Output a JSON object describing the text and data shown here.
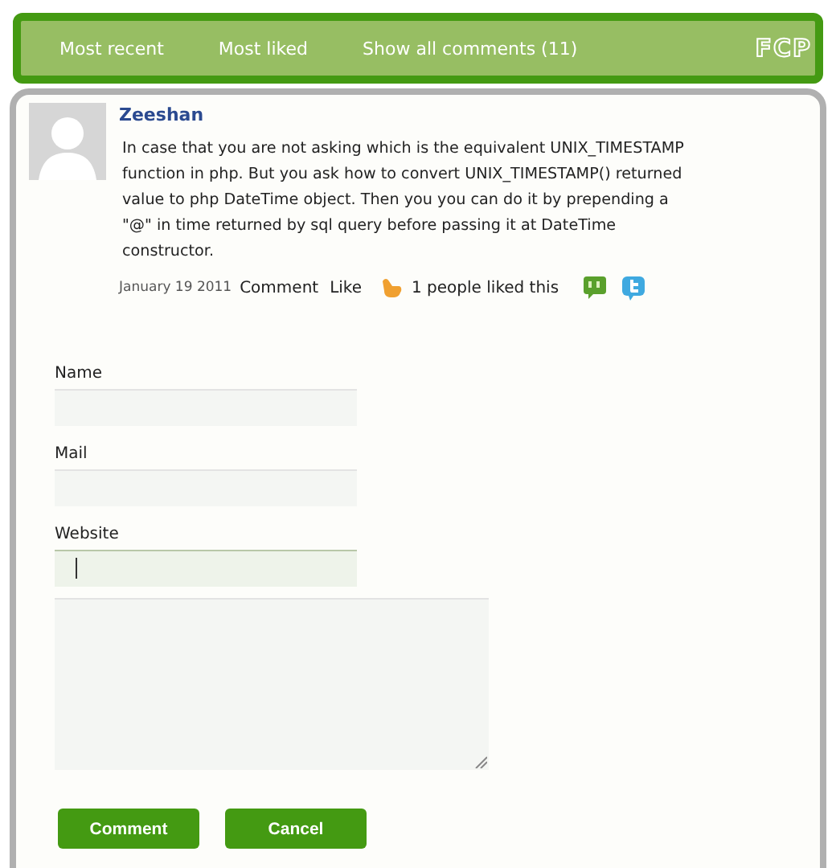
{
  "nav": {
    "tabs": [
      {
        "label": "Most recent"
      },
      {
        "label": "Most liked"
      },
      {
        "label": "Show all comments (11)"
      }
    ],
    "logo": "FCP"
  },
  "comment": {
    "author": "Zeeshan",
    "text": "In case that you are not asking which is the equivalent UNIX_TIMESTAMP function in php. But you ask how to convert UNIX_TIMESTAMP() returned value to php DateTime object. Then you you can do it by prepending a \"@\" in time returned by sql query before passing it at DateTime constructor.",
    "date": "January 19 2011",
    "comment_link": "Comment",
    "like_link": "Like",
    "likes": "1 people liked this"
  },
  "form": {
    "fields": [
      {
        "label": "Name",
        "focused": false
      },
      {
        "label": "Mail",
        "focused": false
      },
      {
        "label": "Website",
        "focused": true
      }
    ],
    "buttons": [
      "Comment",
      "Cancel"
    ]
  }
}
